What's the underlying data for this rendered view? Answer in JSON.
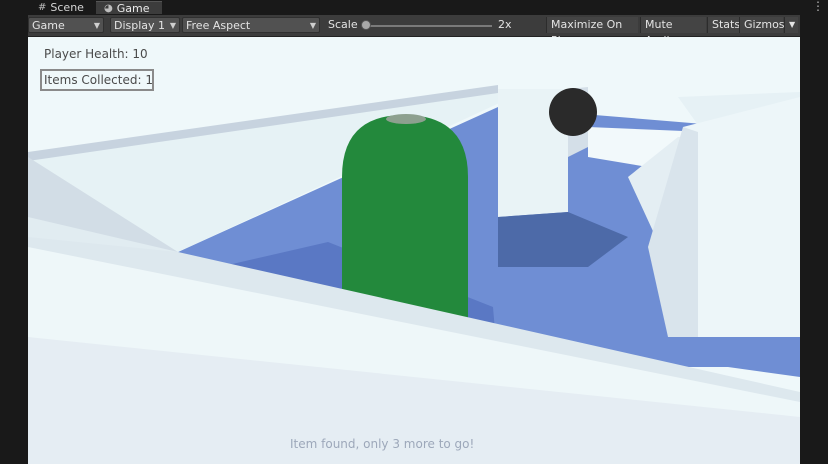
{
  "tabs": {
    "scene": {
      "label": "Scene",
      "icon": "hash-icon"
    },
    "game": {
      "label": "Game",
      "icon": "gamepad-icon"
    }
  },
  "toolbar": {
    "target": "Game",
    "display": "Display 1",
    "aspect": "Free Aspect",
    "scale_label": "Scale",
    "scale_value": "2x",
    "maximize": "Maximize On Play",
    "mute": "Mute Audio",
    "stats": "Stats",
    "gizmos": "Gizmos"
  },
  "hud": {
    "health": "Player Health: 10",
    "items": "Items Collected: 1",
    "message": "Item found, only 3 more to go!"
  },
  "colors": {
    "wall": "#eaf5f8",
    "floor": "#6f8ed4",
    "capsule": "#23893c",
    "hud_text": "#4a4a4a"
  }
}
